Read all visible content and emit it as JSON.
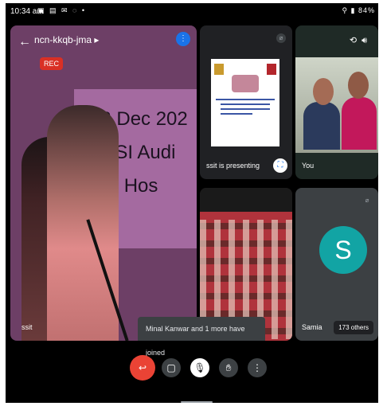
{
  "status_bar": {
    "time": "10:34 am",
    "left_icons": "▣ ▤ ✉ ◌ •",
    "right_text": "⚲ ▮ 84%"
  },
  "meeting": {
    "code": "ncn-kkqb-jma ▸",
    "rec_label": "REC",
    "speaker_name": "ssit"
  },
  "main_slide": {
    "line1": "03 Dec 202",
    "line2": "ue:  RSI Audi",
    "line3": "mmand Hos"
  },
  "tiles": {
    "share": {
      "label": "ssit is presenting"
    },
    "you": {
      "label": "You"
    },
    "audience": {
      "label": ""
    },
    "samia": {
      "initial": "S",
      "label": "Samia",
      "others": "173 others"
    }
  },
  "toast": {
    "text": "Minal Kanwar and 1 more have joined"
  },
  "controls": {
    "end_call": "↩",
    "camera": "▢",
    "mic": "🎙︎",
    "hand": "✋︎",
    "more": "⋮"
  },
  "colors": {
    "rec": "#d93025",
    "end_call": "#ea4335",
    "avatar": "#12a4a4"
  },
  "icons": [
    "back-icon",
    "audio-level-icon",
    "mute-icon",
    "present-icon",
    "camera-switch-icon",
    "speaker-icon",
    "end-call-icon",
    "camera-icon",
    "mic-off-icon",
    "raise-hand-icon",
    "more-icon"
  ]
}
